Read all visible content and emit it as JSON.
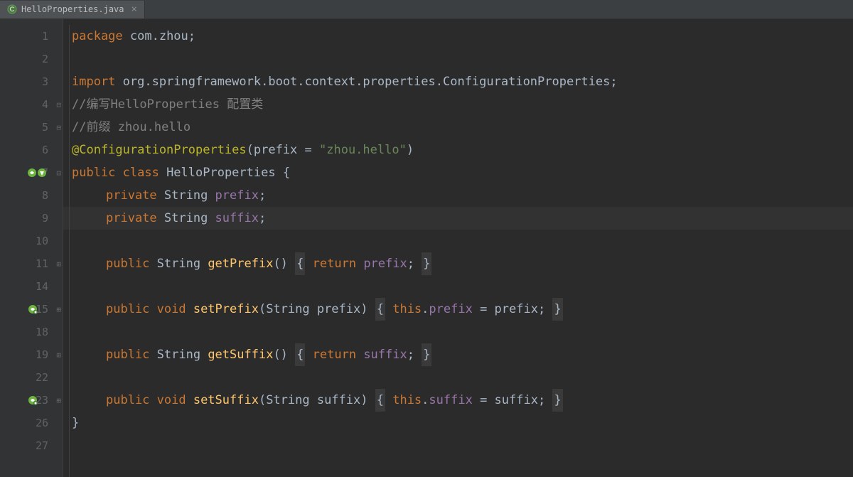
{
  "tab": {
    "filename": "HelloProperties.java",
    "icon": "class-icon"
  },
  "lines": [
    {
      "num": "1",
      "tokens": [
        {
          "t": "package ",
          "c": "kw"
        },
        {
          "t": "com.zhou",
          "c": "pkg"
        },
        {
          "t": ";",
          "c": "punct"
        }
      ]
    },
    {
      "num": "2",
      "tokens": []
    },
    {
      "num": "3",
      "tokens": [
        {
          "t": "import ",
          "c": "kw"
        },
        {
          "t": "org.springframework.boot.context.properties.ConfigurationProperties",
          "c": "pkg"
        },
        {
          "t": ";",
          "c": "punct"
        }
      ]
    },
    {
      "num": "4",
      "fold": "⊟",
      "tokens": [
        {
          "t": "//编写HelloProperties 配置类",
          "c": "comment"
        }
      ]
    },
    {
      "num": "5",
      "fold": "⊟",
      "tokens": [
        {
          "t": "//前缀 zhou.hello",
          "c": "comment"
        }
      ]
    },
    {
      "num": "6",
      "tokens": [
        {
          "t": "@ConfigurationProperties",
          "c": "annotation"
        },
        {
          "t": "(prefix = ",
          "c": "punct"
        },
        {
          "t": "\"zhou.hello\"",
          "c": "str"
        },
        {
          "t": ")",
          "c": "punct"
        }
      ]
    },
    {
      "num": "7",
      "icon": "spring-double",
      "fold": "⊟",
      "tokens": [
        {
          "t": "public class ",
          "c": "kw"
        },
        {
          "t": "HelloProperties",
          "c": "cls"
        },
        {
          "t": " {",
          "c": "punct"
        }
      ]
    },
    {
      "num": "8",
      "indent": 1,
      "tokens": [
        {
          "t": "private ",
          "c": "kw"
        },
        {
          "t": "String ",
          "c": "cls"
        },
        {
          "t": "prefix",
          "c": "field"
        },
        {
          "t": ";",
          "c": "punct"
        }
      ]
    },
    {
      "num": "9",
      "indent": 1,
      "current": true,
      "tokens": [
        {
          "t": "private ",
          "c": "kw"
        },
        {
          "t": "String ",
          "c": "cls"
        },
        {
          "t": "suffix",
          "c": "field"
        },
        {
          "t": ";",
          "c": "punct"
        }
      ]
    },
    {
      "num": "10",
      "tokens": []
    },
    {
      "num": "11",
      "indent": 1,
      "fold": "⊞",
      "tokens": [
        {
          "t": "public ",
          "c": "kw"
        },
        {
          "t": "String ",
          "c": "cls"
        },
        {
          "t": "getPrefix",
          "c": "method"
        },
        {
          "t": "() ",
          "c": "punct"
        },
        {
          "t": "{",
          "c": "punct",
          "hl": true
        },
        {
          "t": " ",
          "c": ""
        },
        {
          "t": "return ",
          "c": "kw"
        },
        {
          "t": "prefix",
          "c": "field"
        },
        {
          "t": ";",
          "c": "punct"
        },
        {
          "t": " ",
          "c": ""
        },
        {
          "t": "}",
          "c": "punct",
          "hl": true
        }
      ]
    },
    {
      "num": "14",
      "tokens": []
    },
    {
      "num": "15",
      "indent": 1,
      "icon": "spring-single",
      "fold": "⊞",
      "tokens": [
        {
          "t": "public void ",
          "c": "kw"
        },
        {
          "t": "setPrefix",
          "c": "method"
        },
        {
          "t": "(String prefix) ",
          "c": "punct"
        },
        {
          "t": "{",
          "c": "punct",
          "hl": true
        },
        {
          "t": " ",
          "c": ""
        },
        {
          "t": "this",
          "c": "kw"
        },
        {
          "t": ".",
          "c": "punct"
        },
        {
          "t": "prefix",
          "c": "field"
        },
        {
          "t": " = prefix; ",
          "c": "punct"
        },
        {
          "t": "}",
          "c": "punct",
          "hl": true
        }
      ]
    },
    {
      "num": "18",
      "tokens": []
    },
    {
      "num": "19",
      "indent": 1,
      "fold": "⊞",
      "tokens": [
        {
          "t": "public ",
          "c": "kw"
        },
        {
          "t": "String ",
          "c": "cls"
        },
        {
          "t": "getSuffix",
          "c": "method"
        },
        {
          "t": "() ",
          "c": "punct"
        },
        {
          "t": "{",
          "c": "punct",
          "hl": true
        },
        {
          "t": " ",
          "c": ""
        },
        {
          "t": "return ",
          "c": "kw"
        },
        {
          "t": "suffix",
          "c": "field"
        },
        {
          "t": ";",
          "c": "punct"
        },
        {
          "t": " ",
          "c": ""
        },
        {
          "t": "}",
          "c": "punct",
          "hl": true
        }
      ]
    },
    {
      "num": "22",
      "tokens": []
    },
    {
      "num": "23",
      "indent": 1,
      "icon": "spring-single",
      "fold": "⊞",
      "tokens": [
        {
          "t": "public void ",
          "c": "kw"
        },
        {
          "t": "setSuffix",
          "c": "method"
        },
        {
          "t": "(String suffix) ",
          "c": "punct"
        },
        {
          "t": "{",
          "c": "punct",
          "hl": true
        },
        {
          "t": " ",
          "c": ""
        },
        {
          "t": "this",
          "c": "kw"
        },
        {
          "t": ".",
          "c": "punct"
        },
        {
          "t": "suffix",
          "c": "field"
        },
        {
          "t": " = suffix; ",
          "c": "punct"
        },
        {
          "t": "}",
          "c": "punct",
          "hl": true
        }
      ]
    },
    {
      "num": "26",
      "tokens": [
        {
          "t": "}",
          "c": "punct"
        }
      ]
    },
    {
      "num": "27",
      "tokens": []
    }
  ]
}
